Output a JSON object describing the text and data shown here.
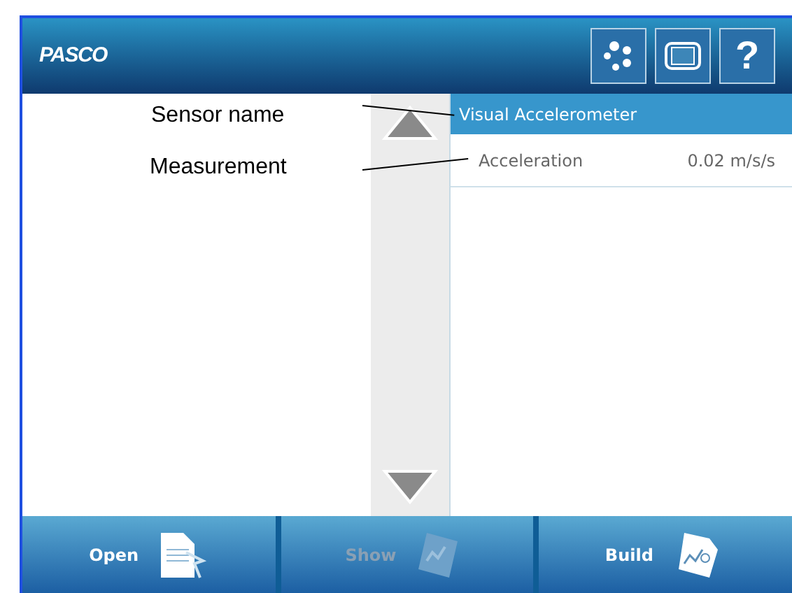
{
  "header": {
    "logo": "PASCO",
    "buttons": [
      {
        "kind": "dots"
      },
      {
        "kind": "device"
      },
      {
        "kind": "help",
        "label": "?"
      }
    ]
  },
  "annotations": [
    {
      "label": "Sensor name"
    },
    {
      "label": "Measurement"
    }
  ],
  "sensor": {
    "name": "Visual Accelerometer",
    "selected": true,
    "measurements": [
      {
        "name": "Acceleration",
        "value": "0.02 m/s/s"
      }
    ]
  },
  "toolbar": [
    {
      "label": "Open",
      "kind": "open",
      "disabled": false
    },
    {
      "label": "Show",
      "kind": "show",
      "disabled": true
    },
    {
      "label": "Build",
      "kind": "build",
      "disabled": false
    }
  ]
}
